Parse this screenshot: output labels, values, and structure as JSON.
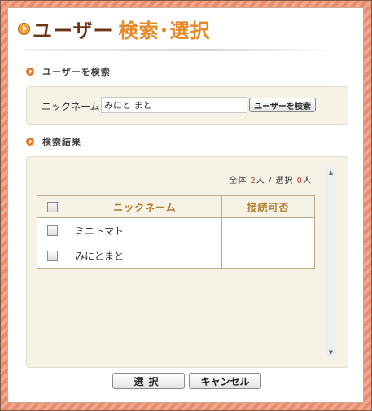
{
  "title": {
    "part1": "ユーザー",
    "part2": "検索･選択"
  },
  "search_section": {
    "heading": "ユーザーを検索",
    "nickname_label": "ニックネーム",
    "nickname_value": "みにと まと",
    "search_button": "ユーザーを検索"
  },
  "results_section": {
    "heading": "検索結果",
    "count": {
      "total_label": "全体",
      "total": "2",
      "unit": "人",
      "separator": "/",
      "selected_label": "選択",
      "selected": "0"
    },
    "columns": [
      "ニックネーム",
      "接続可否"
    ],
    "rows": [
      {
        "nickname": "ミニトマト",
        "status": ""
      },
      {
        "nickname": "みにとまと",
        "status": ""
      }
    ]
  },
  "footer": {
    "select_button": "選択",
    "cancel_button": "キャンセル"
  },
  "colors": {
    "accent": "#e48a2a",
    "title_dark": "#6b3515",
    "count_red": "#c0392b"
  }
}
